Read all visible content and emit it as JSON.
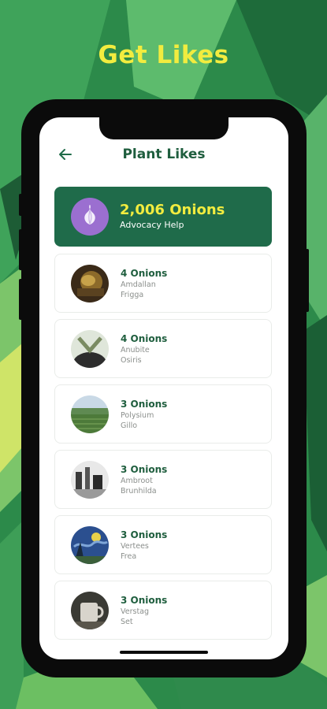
{
  "promo": {
    "headline": "Get Likes"
  },
  "app": {
    "title": "Plant Likes",
    "back_icon": "arrow-left-icon",
    "accent_color": "#1f6b4a",
    "highlight_color": "#f2ec3f"
  },
  "summary": {
    "amount": "2,006 Onions",
    "label": "Advocacy Help",
    "icon": "onion-icon"
  },
  "items": [
    {
      "amount": "4 Onions",
      "line1": "Amdallan",
      "line2": "Frigga"
    },
    {
      "amount": "4 Onions",
      "line1": "Anubite",
      "line2": "Osiris"
    },
    {
      "amount": "3 Onions",
      "line1": "Polysium",
      "line2": "Gillo"
    },
    {
      "amount": "3 Onions",
      "line1": "Ambroot",
      "line2": "Brunhilda"
    },
    {
      "amount": "3 Onions",
      "line1": "Vertees",
      "line2": "Frea"
    },
    {
      "amount": "3 Onions",
      "line1": "Verstag",
      "line2": "Set"
    }
  ]
}
